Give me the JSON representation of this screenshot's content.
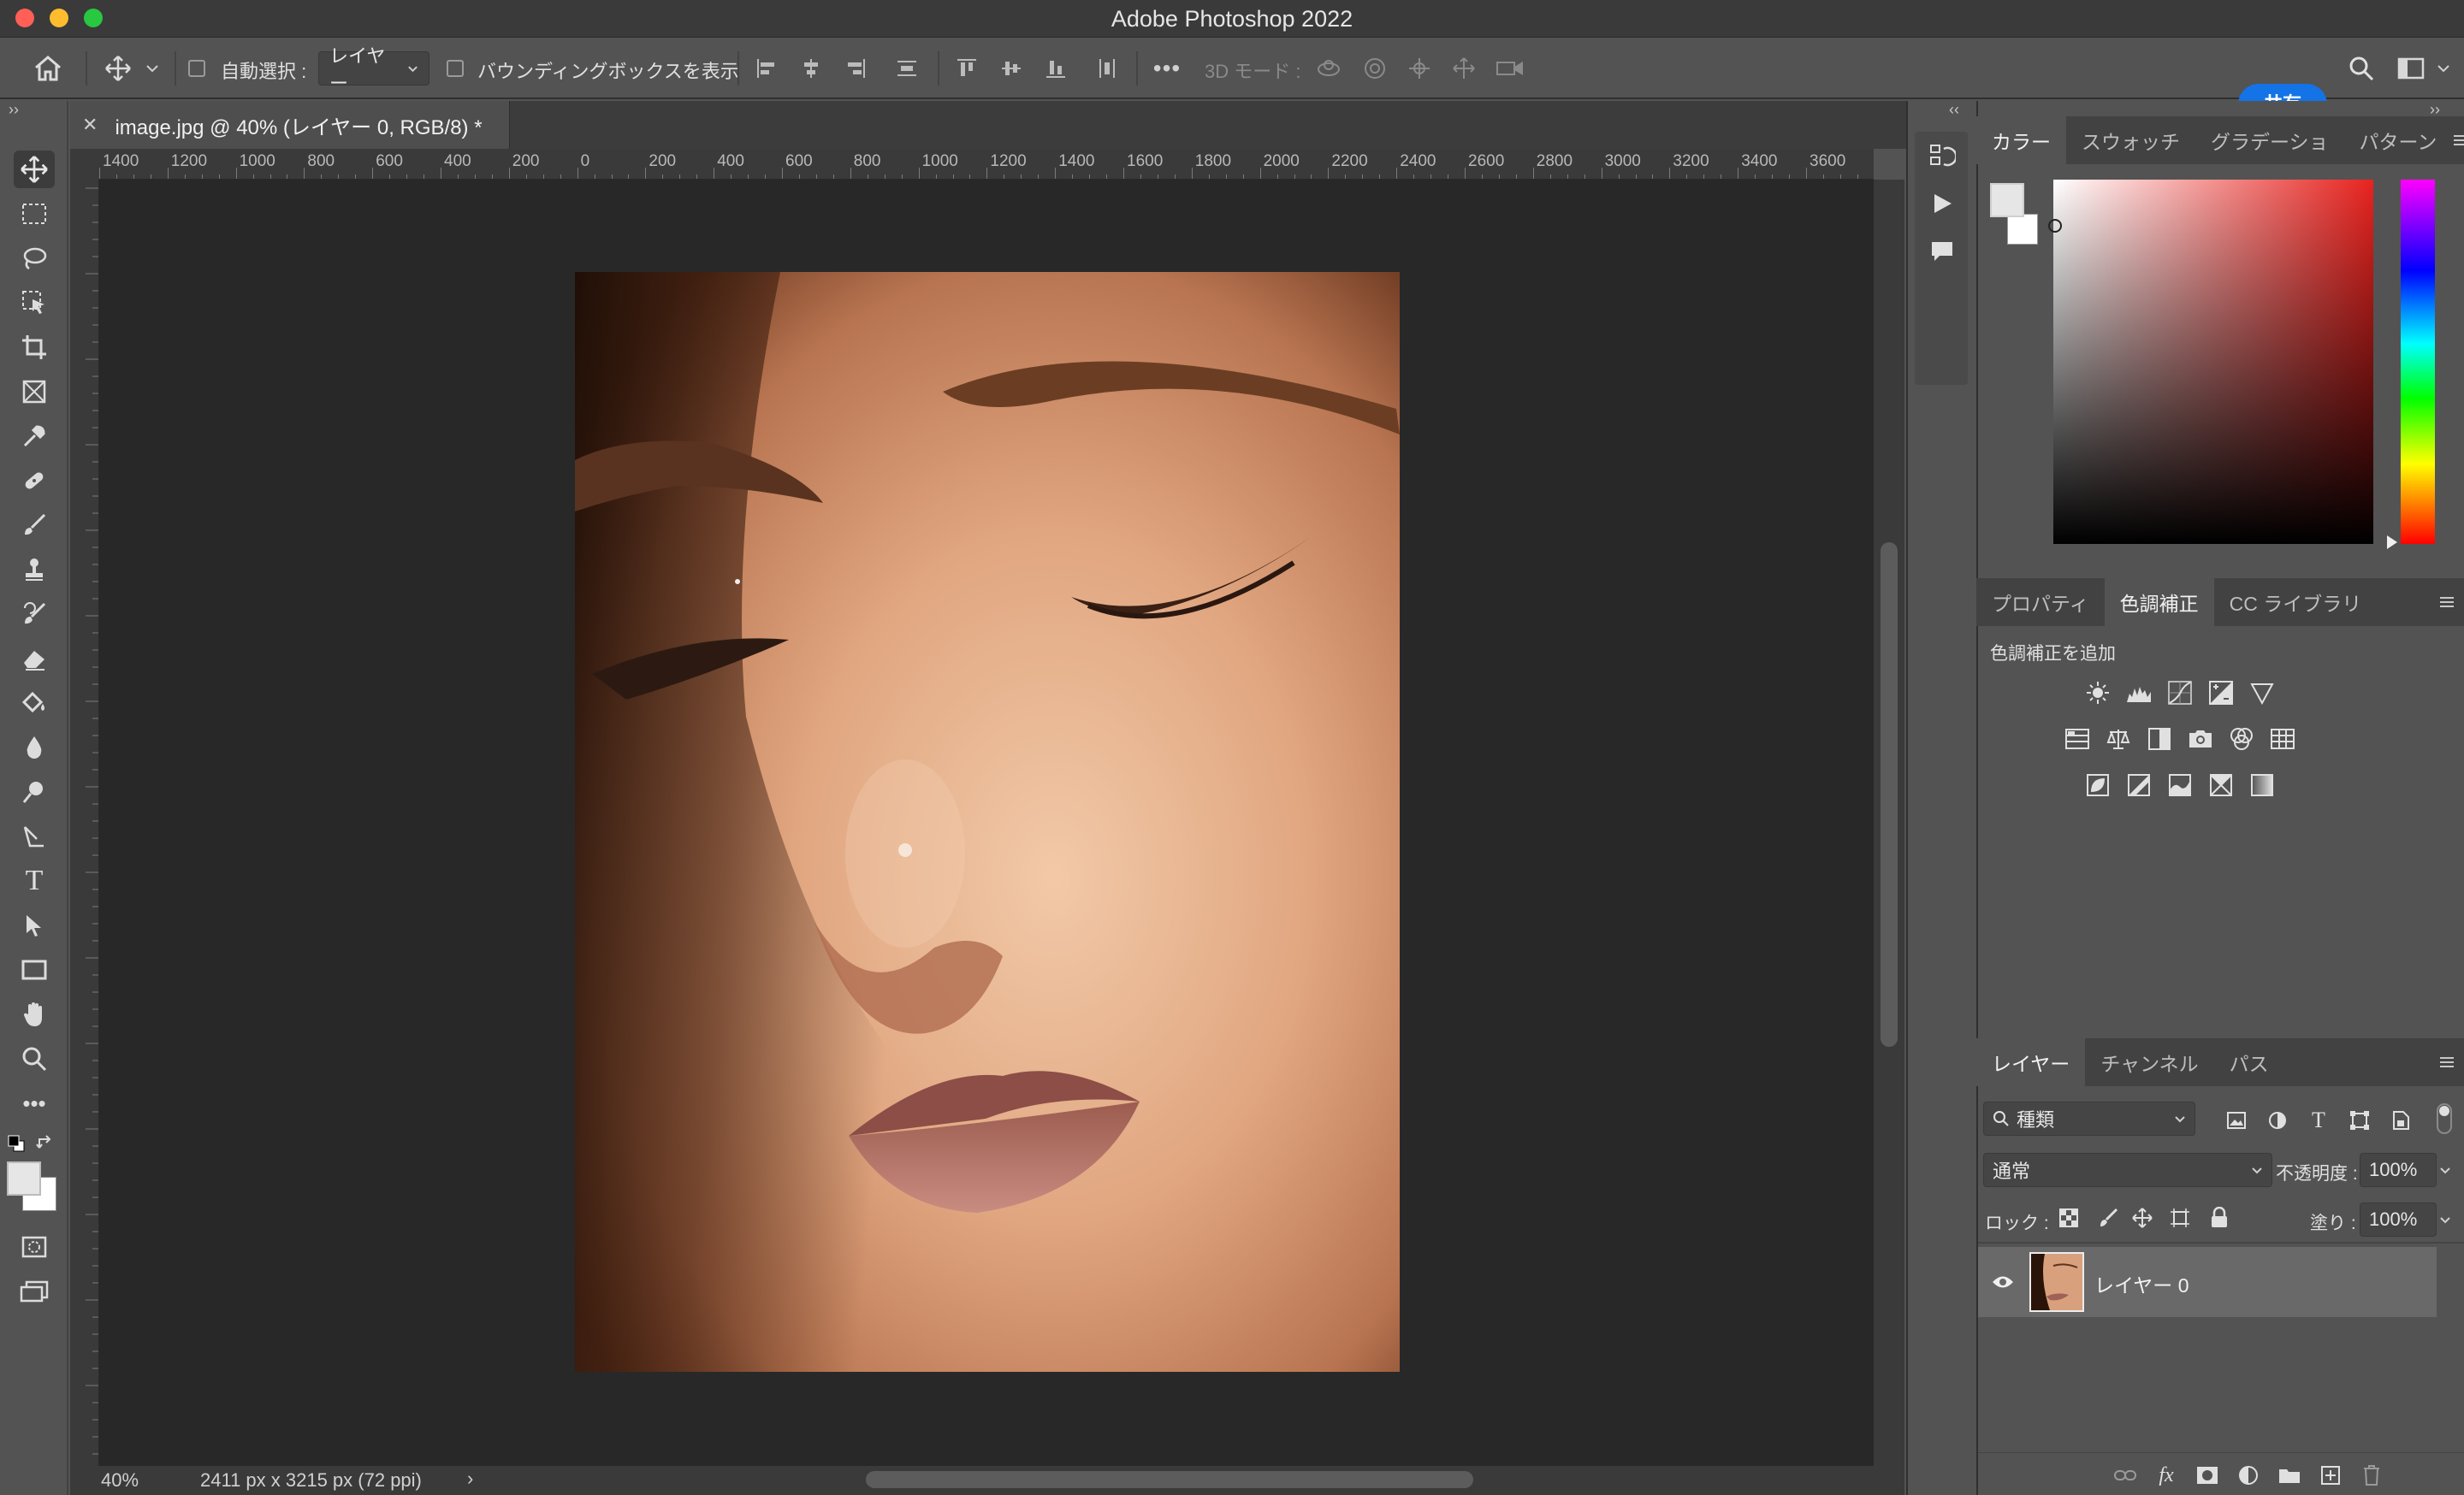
{
  "window": {
    "title": "Adobe Photoshop 2022"
  },
  "options_bar": {
    "auto_select_label": "自動選択 :",
    "auto_select_target": "レイヤー",
    "show_bounding_box_label": "バウンディングボックスを表示",
    "mode_3d_label": "3D モード :",
    "share_label": "共有"
  },
  "document": {
    "tab_title": "image.jpg @ 40% (レイヤー 0, RGB/8) *",
    "zoom": "40%",
    "info": "2411 px x 3215 px (72 ppi)"
  },
  "ruler": {
    "top": [
      "1400",
      "1200",
      "1000",
      "800",
      "600",
      "400",
      "200",
      "0",
      "200",
      "400",
      "600",
      "800",
      "1000",
      "1200",
      "1400",
      "1600",
      "1800",
      "2000",
      "2200",
      "2400",
      "2600",
      "2800",
      "3000",
      "3200",
      "3400",
      "3600"
    ]
  },
  "color_panel": {
    "tabs": [
      "カラー",
      "スウォッチ",
      "グラデーショ",
      "パターン"
    ],
    "active_tab": 0,
    "foreground": "#e6e6e6",
    "background": "#ffffff"
  },
  "adjustments_panel": {
    "tabs": [
      "プロパティ",
      "色調補正",
      "CC ライブラリ"
    ],
    "active_tab": 1,
    "heading": "色調補正を追加"
  },
  "layers_panel": {
    "tabs": [
      "レイヤー",
      "チャンネル",
      "パス"
    ],
    "active_tab": 0,
    "filter_label": "種類",
    "blend_mode": "通常",
    "opacity_label": "不透明度 :",
    "opacity": "100%",
    "lock_label": "ロック :",
    "fill_label": "塗り :",
    "fill": "100%",
    "layers": [
      {
        "name": "レイヤー 0",
        "visible": true
      }
    ]
  },
  "colors": {
    "accent": "#1473e6",
    "close": "#ff5f57",
    "minimize": "#febc2e",
    "zoom": "#28c840"
  }
}
